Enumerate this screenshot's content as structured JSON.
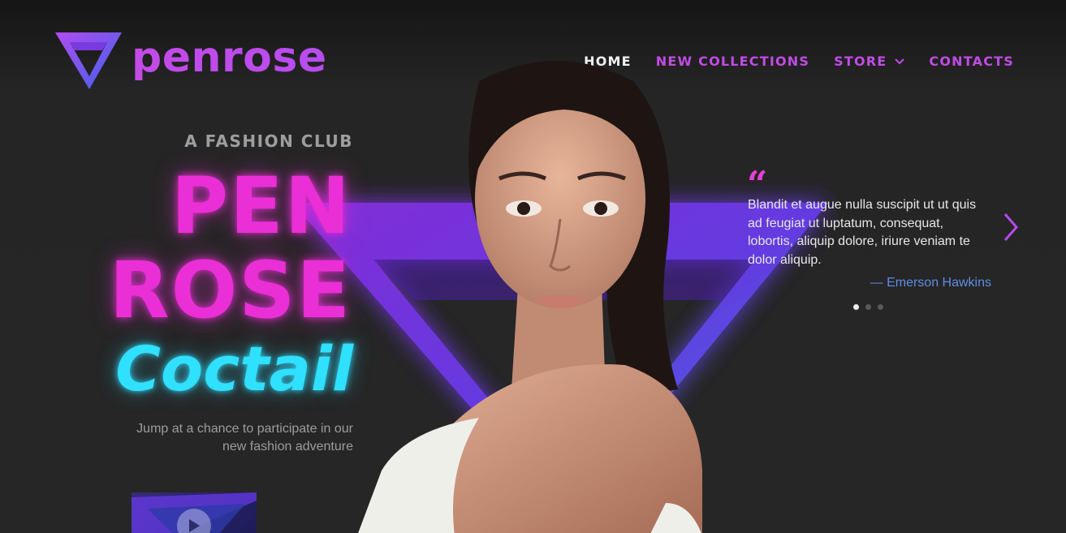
{
  "brand": {
    "name": "penrose",
    "logo_icon": "penrose-triangle-logo",
    "accent": "#c44be6"
  },
  "nav": {
    "items": [
      {
        "label": "HOME",
        "active": true
      },
      {
        "label": "NEW COLLECTIONS",
        "active": false
      },
      {
        "label": "STORE",
        "active": false,
        "icon": "chevron-down-icon"
      },
      {
        "label": "CONTACTS",
        "active": false
      }
    ]
  },
  "hero": {
    "kicker": "A FASHION CLUB",
    "line1": "PEN",
    "line2": "ROSE",
    "script": "Coctail",
    "tagline": "Jump at a chance to participate in our new fashion adventure",
    "video_icon": "play-icon",
    "colors": {
      "pink": "#ea2fd6",
      "cyan": "#2fe0ff"
    }
  },
  "testimonial": {
    "quote_mark": "“",
    "text": "Blandit et augue nulla suscipit ut ut quis ad feugiat ut luptatum, consequat, lobortis, aliquip dolore, iriure veniam te dolor aliquip.",
    "author": "— Emerson Hawkins",
    "active_slide": 1,
    "slide_count": 3,
    "next_icon": "chevron-right-icon"
  }
}
